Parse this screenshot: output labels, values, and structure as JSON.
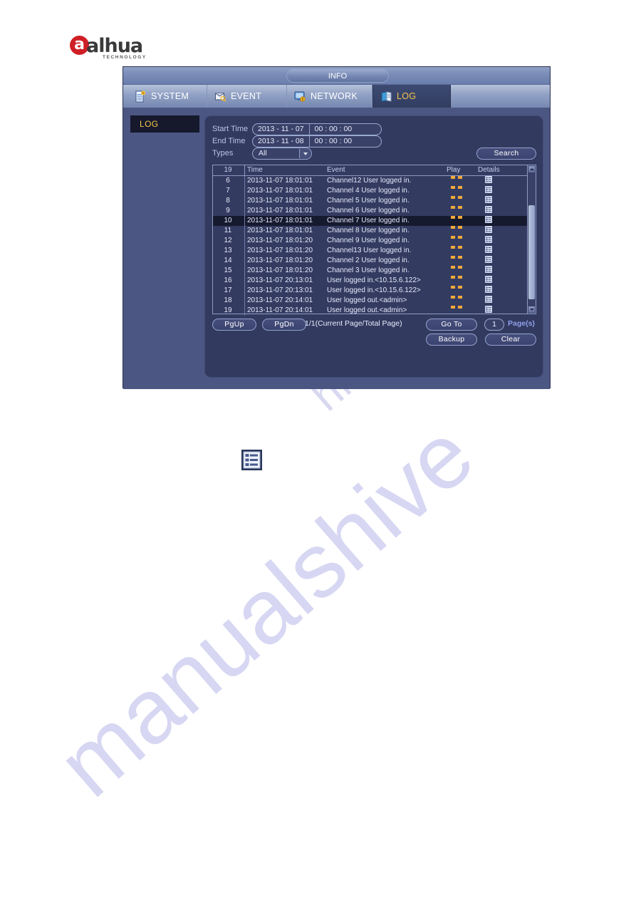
{
  "brand": {
    "name": "alhua",
    "mark_letter": "a",
    "tagline": "TECHNOLOGY",
    "red": "#cf1f26",
    "word_color": "#3a3a3c"
  },
  "watermark": {
    "line1": "manualshive",
    "line2": "hive.com",
    "color": "#c9c9ef"
  },
  "window": {
    "title": "INFO",
    "tabs": [
      {
        "label": "SYSTEM",
        "icon": "system-doc-icon",
        "active": false
      },
      {
        "label": "EVENT",
        "icon": "event-box-icon",
        "active": false
      },
      {
        "label": "NETWORK",
        "icon": "network-monitor-icon",
        "active": false
      },
      {
        "label": "LOG",
        "icon": "log-book-icon",
        "active": true
      }
    ]
  },
  "sidebar": {
    "items": [
      {
        "label": "LOG",
        "selected": true
      }
    ]
  },
  "search_form": {
    "start_time_label": "Start Time",
    "start_date": "2013 - 11 - 07",
    "start_clock": "00 : 00 : 00",
    "end_time_label": "End Time",
    "end_date": "2013 - 11 - 08",
    "end_clock": "00 : 00 : 00",
    "types_label": "Types",
    "types_value": "All",
    "types_options": [
      "All"
    ],
    "search_label": "Search"
  },
  "table": {
    "columns": [
      "19",
      "Time",
      "Event",
      "Play",
      "Details"
    ],
    "count": "19",
    "rows": [
      {
        "no": "6",
        "time": "2013-11-07 18:01:01",
        "event": "Channel12  User logged in.",
        "play": "--",
        "details": "details-list-icon",
        "selected": false
      },
      {
        "no": "7",
        "time": "2013-11-07 18:01:01",
        "event": "Channel 4  User logged in.",
        "play": "--",
        "details": "details-list-icon",
        "selected": false
      },
      {
        "no": "8",
        "time": "2013-11-07 18:01:01",
        "event": "Channel 5  User logged in.",
        "play": "--",
        "details": "details-list-icon",
        "selected": false
      },
      {
        "no": "9",
        "time": "2013-11-07 18:01:01",
        "event": "Channel 6  User logged in.",
        "play": "--",
        "details": "details-list-icon",
        "selected": false
      },
      {
        "no": "10",
        "time": "2013-11-07 18:01:01",
        "event": "Channel 7  User logged in.",
        "play": "--",
        "details": "details-list-icon",
        "selected": true
      },
      {
        "no": "11",
        "time": "2013-11-07 18:01:01",
        "event": "Channel 8  User logged in.",
        "play": "--",
        "details": "details-list-icon",
        "selected": false
      },
      {
        "no": "12",
        "time": "2013-11-07 18:01:20",
        "event": "Channel 9  User logged in.",
        "play": "--",
        "details": "details-list-icon",
        "selected": false
      },
      {
        "no": "13",
        "time": "2013-11-07 18:01:20",
        "event": "Channel13  User logged in.",
        "play": "--",
        "details": "details-list-icon",
        "selected": false
      },
      {
        "no": "14",
        "time": "2013-11-07 18:01:20",
        "event": "Channel 2  User logged in.",
        "play": "--",
        "details": "details-list-icon",
        "selected": false
      },
      {
        "no": "15",
        "time": "2013-11-07 18:01:20",
        "event": "Channel 3  User logged in.",
        "play": "--",
        "details": "details-list-icon",
        "selected": false
      },
      {
        "no": "16",
        "time": "2013-11-07 20:13:01",
        "event": "User logged in.<10.15.6.122>",
        "play": "--",
        "details": "details-list-icon",
        "selected": false
      },
      {
        "no": "17",
        "time": "2013-11-07 20:13:01",
        "event": "User logged in.<10.15.6.122>",
        "play": "--",
        "details": "details-list-icon",
        "selected": false
      },
      {
        "no": "18",
        "time": "2013-11-07 20:14:01",
        "event": "User logged out.<admin>",
        "play": "--",
        "details": "details-list-icon",
        "selected": false
      },
      {
        "no": "19",
        "time": "2013-11-07 20:14:01",
        "event": "User logged out.<admin>",
        "play": "--",
        "details": "details-list-icon",
        "selected": false
      }
    ]
  },
  "pager": {
    "pgup_label": "PgUp",
    "pgdn_label": "PgDn",
    "page_info": "1/1(Current Page/Total Page)",
    "goto_label": "Go To",
    "page_number": "1",
    "pages_label": "Page(s)",
    "backup_label": "Backup",
    "clear_label": "Clear"
  },
  "standalone": {
    "icon": "details-list-icon"
  }
}
